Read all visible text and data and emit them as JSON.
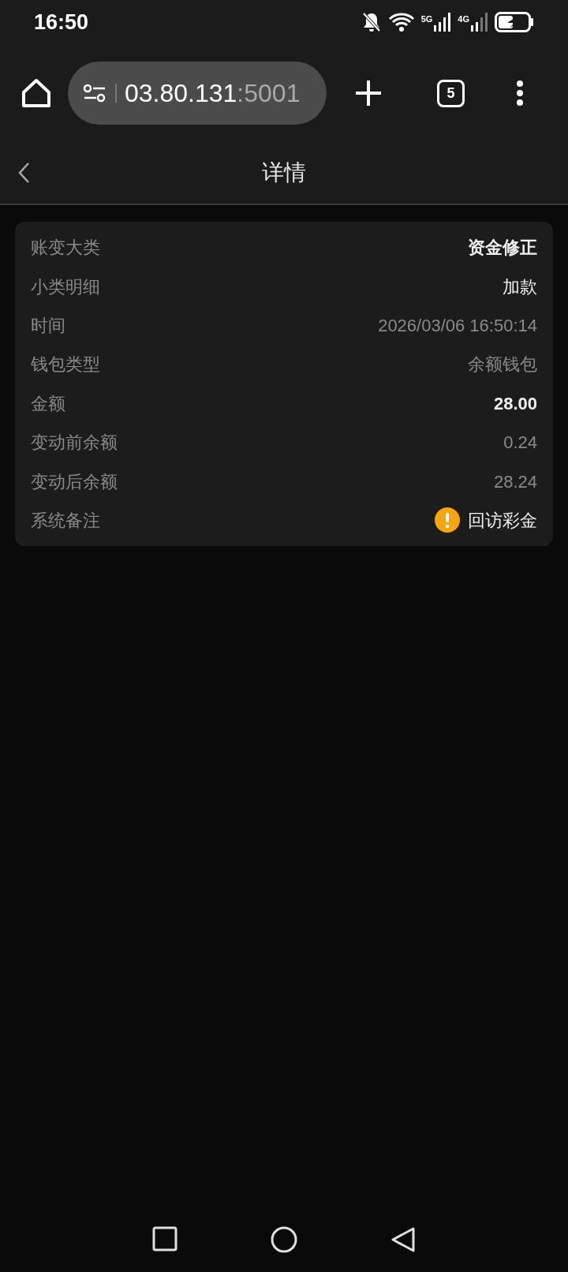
{
  "status_bar": {
    "time": "16:50",
    "network_1": "5G",
    "network_2": "4G"
  },
  "browser": {
    "url_host": "03.80.131",
    "url_port": ":5001",
    "tab_count": "5"
  },
  "header": {
    "title": "详情"
  },
  "details": [
    {
      "label": "账变大类",
      "value": "资金修正",
      "kind": "strong"
    },
    {
      "label": "小类明细",
      "value": "加款",
      "kind": "normal"
    },
    {
      "label": "时间",
      "value": "2026/03/06 16:50:14",
      "kind": "muted"
    },
    {
      "label": "钱包类型",
      "value": "余额钱包",
      "kind": "muted"
    },
    {
      "label": "金额",
      "value": "28.00",
      "kind": "strong"
    },
    {
      "label": "变动前余额",
      "value": "0.24",
      "kind": "muted"
    },
    {
      "label": "变动后余额",
      "value": "28.24",
      "kind": "muted"
    },
    {
      "label": "系统备注",
      "value": "回访彩金",
      "kind": "note"
    }
  ]
}
